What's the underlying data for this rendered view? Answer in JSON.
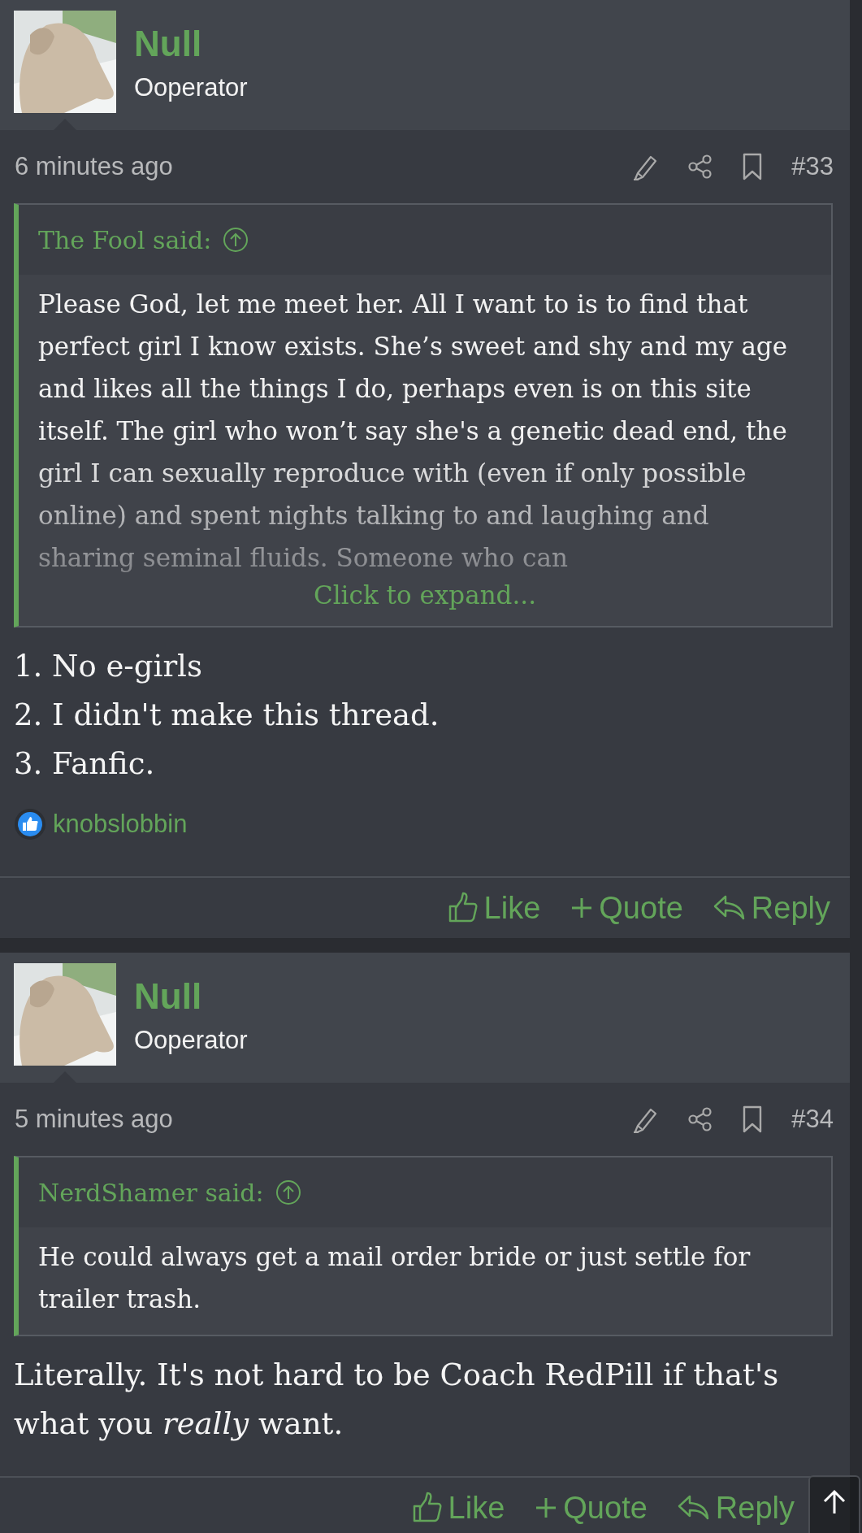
{
  "posts": [
    {
      "author": {
        "name": "Null",
        "title": "Ooperator"
      },
      "time": "6 minutes ago",
      "number": "#33",
      "quote": {
        "author_label": "The Fool said:",
        "collapsed": true,
        "text": "Please God, let me meet her. All I want to is to find that perfect girl I know exists. She’s sweet and shy and my age and likes all the things I do, perhaps even is on this site itself. The girl who won’t say she's a genetic dead end, the girl I can sexually reproduce with (even if only possible online) and spent nights talking to and laughing and sharing seminal fluids. Someone who can",
        "expand_label": "Click to expand..."
      },
      "body": [
        "1. No e-girls",
        "2. I didn't make this thread.",
        "3. Fanfic."
      ],
      "reactions": [
        {
          "user": "knobslobbin"
        }
      ],
      "actions": [
        {
          "kind": "like",
          "label": "Like"
        },
        {
          "kind": "quote",
          "label": "Quote"
        },
        {
          "kind": "reply",
          "label": "Reply"
        }
      ]
    },
    {
      "author": {
        "name": "Null",
        "title": "Ooperator"
      },
      "time": "5 minutes ago",
      "number": "#34",
      "quote": {
        "author_label": "NerdShamer said:",
        "collapsed": false,
        "text": "He could always get a mail order bride or just settle for trailer trash."
      },
      "body": [
        "Literally. It's not hard to be Coach RedPill if that's what you *really* want."
      ],
      "actions": [
        {
          "kind": "like",
          "label": "Like"
        },
        {
          "kind": "quote",
          "label": "Quote"
        },
        {
          "kind": "reply",
          "label": "Reply"
        }
      ]
    }
  ]
}
